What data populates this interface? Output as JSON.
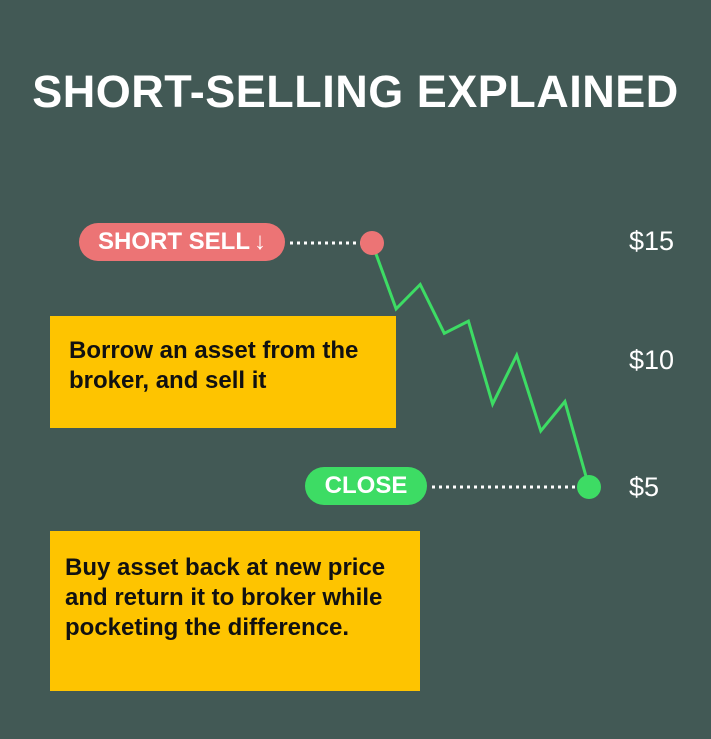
{
  "title": "SHORT-SELLING EXPLAINED",
  "labels": {
    "short_sell": "SHORT SELL",
    "short_sell_arrow": "↓",
    "close": "CLOSE"
  },
  "prices": {
    "p15": "$15",
    "p10": "$10",
    "p5": "$5"
  },
  "notes": {
    "borrow": "Borrow an asset from the broker, and sell it",
    "buy_back": "Buy asset back at new price and return it to broker while pocketing the difference."
  },
  "colors": {
    "background": "#425955",
    "short": "#ec7475",
    "close": "#3ddc64",
    "line": "#3ddc64",
    "note": "#fec400"
  },
  "chart_data": {
    "type": "line",
    "y_ticks": [
      15,
      10,
      5
    ],
    "series": [
      {
        "values": [
          15,
          12.3,
          13.3,
          11.3,
          11.8,
          8.4,
          10.4,
          7.3,
          8.5,
          5
        ]
      }
    ]
  }
}
